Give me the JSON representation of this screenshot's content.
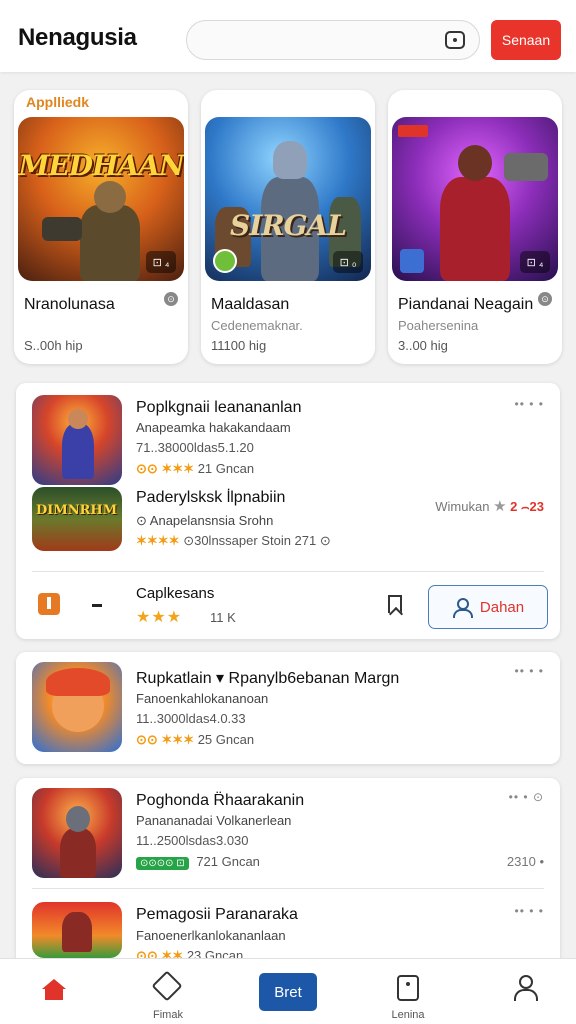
{
  "header": {
    "logo": "Nenagusia",
    "search_placeholder": "",
    "signin_label": "Senaan",
    "search_icon": "camera-icon"
  },
  "featured": {
    "tag": "Applliedk",
    "cards": [
      {
        "art_title": "MEDHAAN",
        "badge": "⊡ ₄",
        "name": "Nranolunasa",
        "sub": "",
        "meta": "S..00h  hip"
      },
      {
        "art_title": "SIRGAL",
        "badge": "⊡ ₀",
        "name": "Maaldasan",
        "sub": "Cedenemaknar.",
        "meta": "11100  hig"
      },
      {
        "art_title": "",
        "badge": "⊡ ₄",
        "name": "Piandanai Neagain",
        "sub": "Poahersenina",
        "meta": "3..00  hig"
      }
    ]
  },
  "list1": {
    "rows": [
      {
        "title": "Poplkgnaii leanananlan",
        "sub": "Anapeamka hakakandaam",
        "stats": "71..38000ldas5.1.20",
        "meta_stars": "⊙⊙ ✶✶✶",
        "meta_text": "21 Gncan",
        "dots": "•• • •"
      },
      {
        "title": "Paderylsksk l̇lpnabiin",
        "sub": "⊙  Anapelansnsia Srohn",
        "meta_stars": "✶✶✶✶",
        "meta_text": "⊙30lnssaper  Stoin 271 ⊙",
        "side_label": "Wimukan",
        "side_star": "★",
        "side_num": "2 ⌢23"
      }
    ],
    "action": {
      "title": "Caplkesans",
      "rating": "★★★",
      "count": "11 K",
      "button_label": "Dahan"
    }
  },
  "list2": {
    "rows": [
      {
        "title": "Rupkatlain ▾ Rpanylb6ebanan Margn",
        "sub": "Fanoenkahlokananoan",
        "stats": "11..3000ldas4.0.33",
        "meta_stars": "⊙⊙ ✶✶✶",
        "meta_text": "25 Gncan",
        "dots": "•• • •"
      }
    ]
  },
  "list3": {
    "rows": [
      {
        "title": "Poghonda R̈haarakanin",
        "sub": "Panananadai Volkanerlean",
        "stats": "11..2500lsdas3.030",
        "chip": "⊙⊙⊙⊙ ⊡",
        "meta_text": "721 Gncan",
        "dots": "•• • ⊙",
        "side_num": "2310 •"
      },
      {
        "title": "Pemagosii Paranaraka",
        "sub": "Fanoenerlkanlokananlaan",
        "meta_stars": "⊙⊙ ✶✶",
        "meta_text": "23 Gncan",
        "dots": "•• • •"
      }
    ]
  },
  "bottom_nav": {
    "items": [
      {
        "label": "",
        "icon": "home-icon"
      },
      {
        "label": "Fimak",
        "icon": "tag-icon"
      },
      {
        "label": "Bret",
        "icon": "button"
      },
      {
        "label": "Lenina",
        "icon": "document-icon"
      },
      {
        "label": "",
        "icon": "user-icon"
      }
    ]
  },
  "colors": {
    "accent_red": "#e8342b",
    "primary_blue": "#1d57a8",
    "star_orange": "#f39b13",
    "green": "#27a348"
  }
}
